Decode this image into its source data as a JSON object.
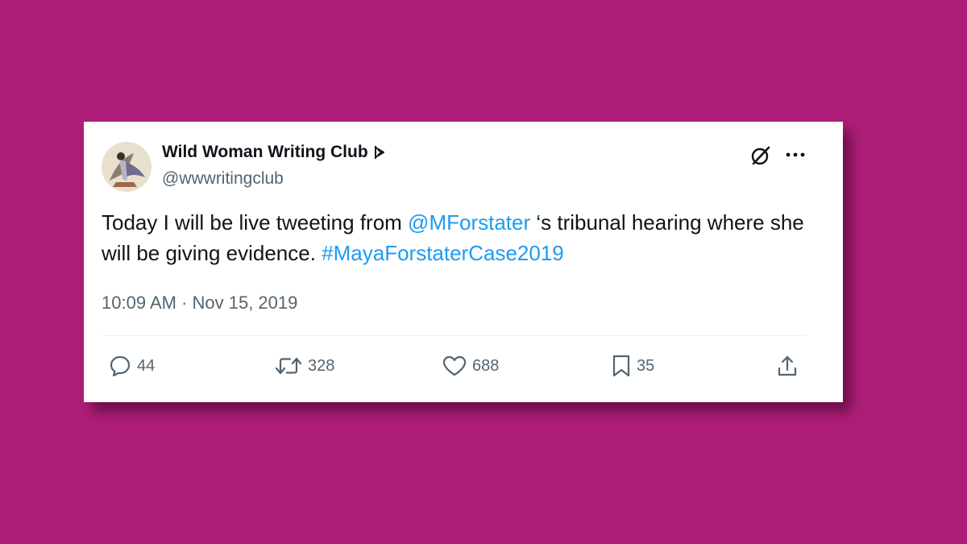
{
  "tweet": {
    "author_name": "Wild Woman Writing Club",
    "handle": "@wwwritingclub",
    "text_part1": "Today I will be live tweeting from ",
    "mention": "@MForstater",
    "text_part2": " ‘s tribunal hearing where she will be giving evidence. ",
    "hashtag": "#MayaForstaterCase2019",
    "timestamp": "10:09 AM · Nov 15, 2019"
  },
  "actions": {
    "replies": "44",
    "retweets": "328",
    "likes": "688",
    "bookmarks": "35"
  },
  "icons": {
    "badge": "badge-icon",
    "grok": "grok-icon",
    "more": "more-icon",
    "reply": "reply-icon",
    "retweet": "retweet-icon",
    "like": "heart-icon",
    "bookmark": "bookmark-icon",
    "share": "share-icon"
  },
  "colors": {
    "background": "#ad1e78",
    "link": "#1d9bf0",
    "secondary_text": "#536471",
    "primary_text": "#0f1419"
  }
}
